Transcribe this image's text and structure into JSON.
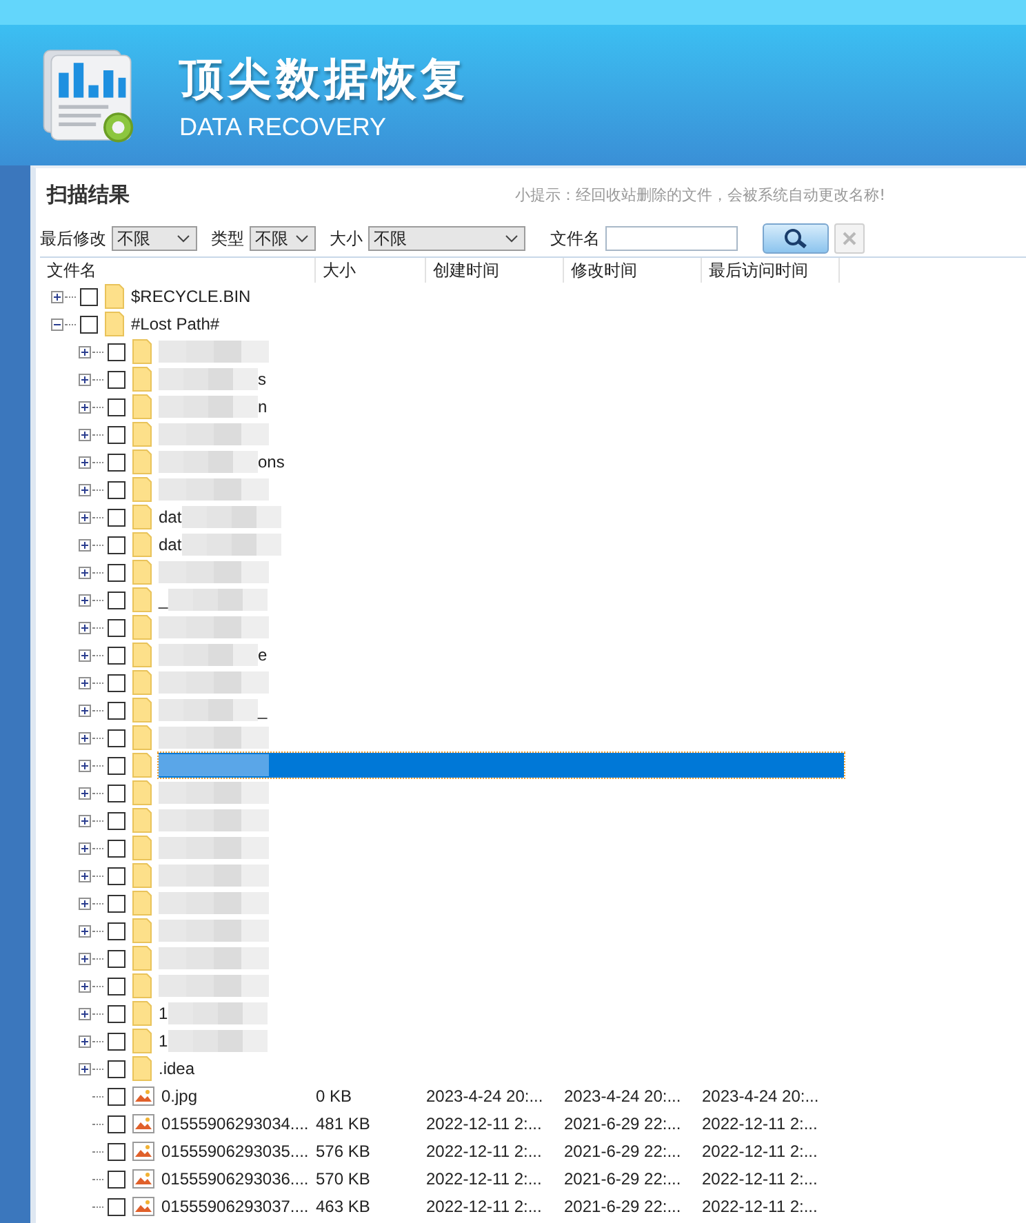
{
  "app": {
    "title": "顶尖数据恢复",
    "subtitle": "DATA RECOVERY"
  },
  "panel": {
    "title": "扫描结果",
    "hint": "小提示：经回收站删除的文件，会被系统自动更改名称!"
  },
  "filters": [
    {
      "label": "最后修改",
      "value": "不限",
      "kind": "select"
    },
    {
      "label": "类型",
      "value": "不限",
      "kind": "select"
    },
    {
      "label": "大小",
      "value": "不限",
      "kind": "select"
    },
    {
      "label": "文件名",
      "kind": "text"
    }
  ],
  "search_button": {
    "disabled": false
  },
  "clear_button": {
    "disabled": true
  },
  "columns": [
    "文件名",
    "大小",
    "创建时间",
    "修改时间",
    "最后访问时间"
  ],
  "tree": [
    {
      "kind": "folder",
      "name": "$RECYCLE.BIN",
      "checked": false,
      "expanded": false,
      "selected": false
    },
    {
      "kind": "folder",
      "name": "#Lost Path#",
      "checked": false,
      "expanded": true,
      "selected": false,
      "children": [
        {
          "kind": "folder",
          "blurred_before": true,
          "checked": false,
          "expanded": false,
          "selected": false
        },
        {
          "kind": "folder",
          "name": "s",
          "blurred_before": true,
          "checked": false,
          "expanded": false,
          "selected": false
        },
        {
          "kind": "folder",
          "name": "n",
          "blurred_before": true,
          "checked": false,
          "expanded": false,
          "selected": false
        },
        {
          "kind": "folder",
          "blurred_before": true,
          "checked": false,
          "expanded": false,
          "selected": false
        },
        {
          "kind": "folder",
          "name": "ons",
          "blurred_before": true,
          "checked": false,
          "expanded": false,
          "selected": false
        },
        {
          "kind": "folder",
          "blurred_before": true,
          "checked": false,
          "expanded": false,
          "selected": false
        },
        {
          "kind": "folder",
          "name": "dat",
          "blurred_after": true,
          "checked": false,
          "expanded": false,
          "selected": false
        },
        {
          "kind": "folder",
          "name": "dat",
          "blurred_after": true,
          "checked": false,
          "expanded": false,
          "selected": false
        },
        {
          "kind": "folder",
          "blurred_before": true,
          "checked": false,
          "expanded": false,
          "selected": false
        },
        {
          "kind": "folder",
          "name": "_",
          "blurred_after": true,
          "checked": false,
          "expanded": false,
          "selected": false
        },
        {
          "kind": "folder",
          "blurred_before": true,
          "checked": false,
          "expanded": false,
          "selected": false
        },
        {
          "kind": "folder",
          "name": "e",
          "blurred_before": true,
          "checked": false,
          "expanded": false,
          "selected": false
        },
        {
          "kind": "folder",
          "blurred_before": true,
          "checked": false,
          "expanded": false,
          "selected": false
        },
        {
          "kind": "folder",
          "name": "_",
          "blurred_before": true,
          "checked": false,
          "expanded": false,
          "selected": false
        },
        {
          "kind": "folder",
          "blurred_before": true,
          "checked": false,
          "expanded": false,
          "selected": false
        },
        {
          "kind": "folder",
          "blurred_before": true,
          "checked": false,
          "expanded": false,
          "selected": true
        },
        {
          "kind": "folder",
          "blurred_before": true,
          "checked": false,
          "expanded": false,
          "selected": false
        },
        {
          "kind": "folder",
          "blurred_before": true,
          "checked": false,
          "expanded": false,
          "selected": false
        },
        {
          "kind": "folder",
          "blurred_before": true,
          "checked": false,
          "expanded": false,
          "selected": false
        },
        {
          "kind": "folder",
          "blurred_before": true,
          "checked": false,
          "expanded": false,
          "selected": false
        },
        {
          "kind": "folder",
          "blurred_before": true,
          "checked": false,
          "expanded": false,
          "selected": false
        },
        {
          "kind": "folder",
          "blurred_before": true,
          "checked": false,
          "expanded": false,
          "selected": false
        },
        {
          "kind": "folder",
          "blurred_before": true,
          "checked": false,
          "expanded": false,
          "selected": false
        },
        {
          "kind": "folder",
          "blurred_before": true,
          "checked": false,
          "expanded": false,
          "selected": false
        },
        {
          "kind": "folder",
          "name": "1",
          "blurred_after": true,
          "checked": false,
          "expanded": false,
          "selected": false
        },
        {
          "kind": "folder",
          "name": "1",
          "blurred_after": true,
          "checked": false,
          "expanded": false,
          "selected": false
        },
        {
          "kind": "folder",
          "name": ".idea",
          "checked": false,
          "expanded": false,
          "selected": false
        },
        {
          "kind": "file",
          "name": "0.jpg",
          "size": "0 KB",
          "created": "2023-4-24 20:...",
          "modified": "2023-4-24 20:...",
          "accessed": "2023-4-24 20:...",
          "checked": false,
          "selected": false
        },
        {
          "kind": "file",
          "name": "01555906293034....",
          "size": "481 KB",
          "created": "2022-12-11 2:...",
          "modified": "2021-6-29 22:...",
          "accessed": "2022-12-11 2:...",
          "checked": false,
          "selected": false
        },
        {
          "kind": "file",
          "name": "01555906293035....",
          "size": "576 KB",
          "created": "2022-12-11 2:...",
          "modified": "2021-6-29 22:...",
          "accessed": "2022-12-11 2:...",
          "checked": false,
          "selected": false
        },
        {
          "kind": "file",
          "name": "01555906293036....",
          "size": "570 KB",
          "created": "2022-12-11 2:...",
          "modified": "2021-6-29 22:...",
          "accessed": "2022-12-11 2:...",
          "checked": false,
          "selected": false
        },
        {
          "kind": "file",
          "name": "01555906293037....",
          "size": "463 KB",
          "created": "2022-12-11 2:...",
          "modified": "2021-6-29 22:...",
          "accessed": "2022-12-11 2:...",
          "checked": false,
          "selected": false
        }
      ]
    }
  ]
}
